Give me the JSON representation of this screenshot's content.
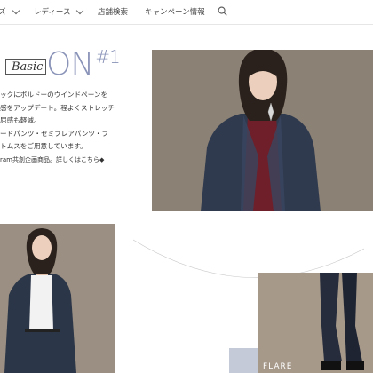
{
  "nav": {
    "items": [
      {
        "label": "ズ"
      },
      {
        "label": "レディース"
      },
      {
        "label": "店舗検索"
      },
      {
        "label": "キャンペーン情報"
      }
    ],
    "search_icon": "search-icon"
  },
  "hero": {
    "title_script": "Basic",
    "title_main": "ON",
    "title_number": "#1",
    "copy_lines": [
      "ックにボルドーのウインドペーンを",
      "感をアップデート。程よくストレッチ",
      "屈感も軽減。",
      "ードパンツ・セミフレアパンツ・フ",
      "トムスをご用意しています。"
    ],
    "note_prefix": "ram共創企画商品。詳しくは",
    "note_link": "こちら",
    "note_suffix": "◆"
  },
  "flare_label": "FLARE"
}
